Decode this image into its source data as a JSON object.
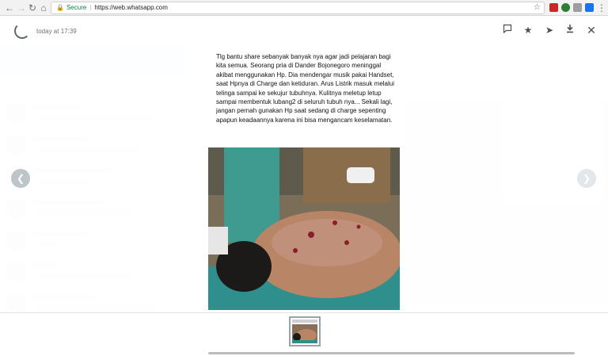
{
  "browser": {
    "secure_label": "Secure",
    "url": "https://web.whatsapp.com"
  },
  "viewer": {
    "timestamp": "today at 17:39",
    "caption": "Tlg bantu share sebanyak banyak nya agar jadi pelajaran bagi kita semua. Seorang pria di Dander Bojonegoro meninggal akibat menggunakan Hp. Dia mendengar musik pakai Handset, saat Hpnya di Charge dan ketiduran. Arus Listrik masuk melalui telinga sampai ke sekujur tubuhnya. Kulitnya meletup letup sampai membentuk lubang2 di seluruh tubuh nya... Sekali lagi, jangan pernah gunakan Hp saat sedang di charge sepenting apapun keadaannya karena ini bisa mengancam keselamatan."
  },
  "icons": {
    "back": "back-arrow-icon",
    "forward": "forward-arrow-icon",
    "reload": "reload-icon",
    "home": "home-icon",
    "lock": "lock-icon",
    "bookmark": "star-icon",
    "message": "message-icon",
    "star": "star-icon",
    "forward_msg": "forward-icon",
    "download": "download-icon",
    "close": "close-icon",
    "prev": "chevron-left-icon",
    "next": "chevron-right-icon"
  },
  "colors": {
    "secure": "#0b8043",
    "arrow_bg": "#c9d0d3"
  }
}
